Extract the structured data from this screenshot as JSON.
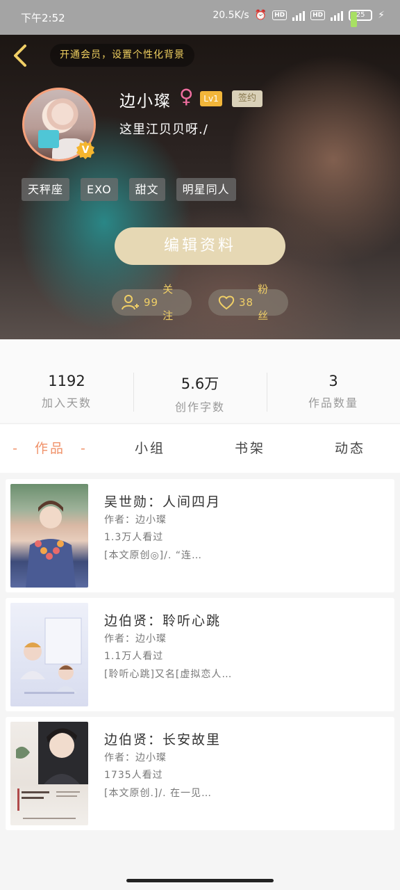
{
  "status_bar": {
    "time": "下午2:52",
    "net_speed": "20.5K/s",
    "hd": "HD",
    "battery": "25"
  },
  "header": {
    "vip_prompt": "开通会员，设置个性化背景",
    "username": "边小璨",
    "gender_symbol": "♀",
    "level": "Lv1",
    "signed_label": "签约",
    "bio": "这里江贝贝呀./",
    "badge_letter": "V",
    "tags": [
      "天秤座",
      "EXO",
      "甜文",
      "明星同人"
    ],
    "edit_button": "编辑资料",
    "follow_count": "99",
    "follow_label": "关注",
    "fans_count": "38",
    "fans_label": "粉丝"
  },
  "stats": [
    {
      "value": "1192",
      "label": "加入天数"
    },
    {
      "value": "5.6万",
      "label": "创作字数"
    },
    {
      "value": "3",
      "label": "作品数量"
    }
  ],
  "tabs": [
    "-　作品　-",
    "小组",
    "书架",
    "动态"
  ],
  "works": [
    {
      "title": "吴世勋：人间四月",
      "author": "作者：边小璨",
      "views": "1.3万人看过",
      "desc": "[本文原创◎]/. “连…"
    },
    {
      "title": "边伯贤：聆听心跳",
      "author": "作者：边小璨",
      "views": "1.1万人看过",
      "desc": "[聆听心跳]又名[虚拟恋人…"
    },
    {
      "title": "边伯贤：长安故里",
      "author": "作者：边小璨",
      "views": "1735人看过",
      "desc": "[本文原创.]/. 在一见…"
    }
  ],
  "colors": {
    "accent": "#f0926a",
    "gold": "#f0cf66",
    "edit_button": "#e6d8b4"
  }
}
